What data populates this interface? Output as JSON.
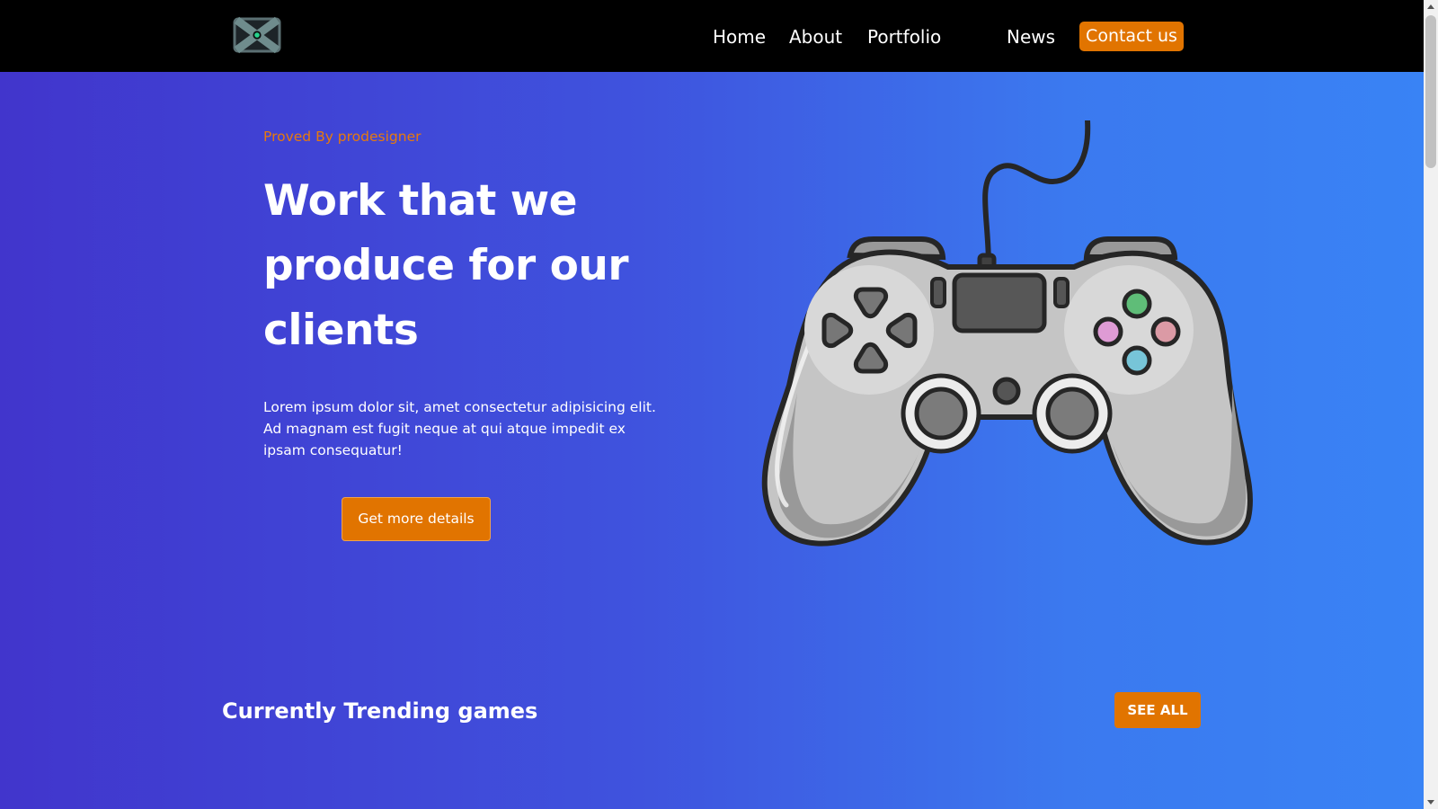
{
  "app": {
    "title": ""
  },
  "nav": {
    "logo_icon": "x-logo-icon",
    "links": {
      "home": "Home",
      "about": "About",
      "portfolio": "Portfolio",
      "news": "News"
    },
    "contact": "Contact us"
  },
  "hero": {
    "kicker": "Proved By prodesigner",
    "title": "Work that we produce for our clients",
    "copy": "Lorem ipsum dolor sit, amet consectetur adipisicing elit. Ad magnam est fugit neque at qui atque impedit ex ipsam consequatur!",
    "button": "Get more details",
    "illustration": "game-controller-icon"
  },
  "trending": {
    "title": "Currently Trending games",
    "button": "SEE ALL"
  },
  "colors": {
    "accent": "#e17400",
    "background_start": "#4135cc",
    "background_end": "#3983f5",
    "navbar": "#000000",
    "kicker": "#e77a0d"
  }
}
